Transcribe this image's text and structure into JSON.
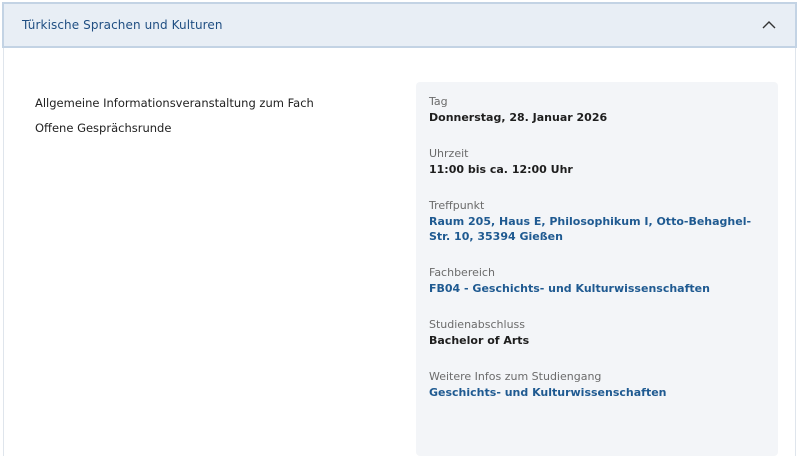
{
  "accordion": {
    "title": "Türkische Sprachen und Kulturen",
    "expanded": true,
    "toggle_icon": "chevron-up-icon"
  },
  "description": {
    "lines": [
      "Allgemeine Informationsveranstaltung zum Fach",
      "Offene Gesprächsrunde"
    ]
  },
  "details": {
    "date": {
      "label": "Tag",
      "value": "Donnerstag, 28. Januar 2026"
    },
    "time": {
      "label": "Uhrzeit",
      "value": "11:00 bis ca. 12:00 Uhr"
    },
    "location": {
      "label": "Treffpunkt",
      "value": "Raum 205, Haus E, Philosophikum I, Otto-Behaghel-Str. 10, 35394 Gießen"
    },
    "department": {
      "label": "Fachbereich",
      "value": "FB04 - Geschichts- und Kulturwissenschaften"
    },
    "degree": {
      "label": "Studienabschluss",
      "value": "Bachelor of Arts"
    },
    "more_info": {
      "label": "Weitere Infos zum Studiengang",
      "value": "Geschichts- und Kulturwissenschaften"
    }
  },
  "colors": {
    "header_bg": "#e8eef5",
    "header_border": "#c3d3e4",
    "link": "#1f5a91",
    "info_box_bg": "#f3f5f8"
  }
}
